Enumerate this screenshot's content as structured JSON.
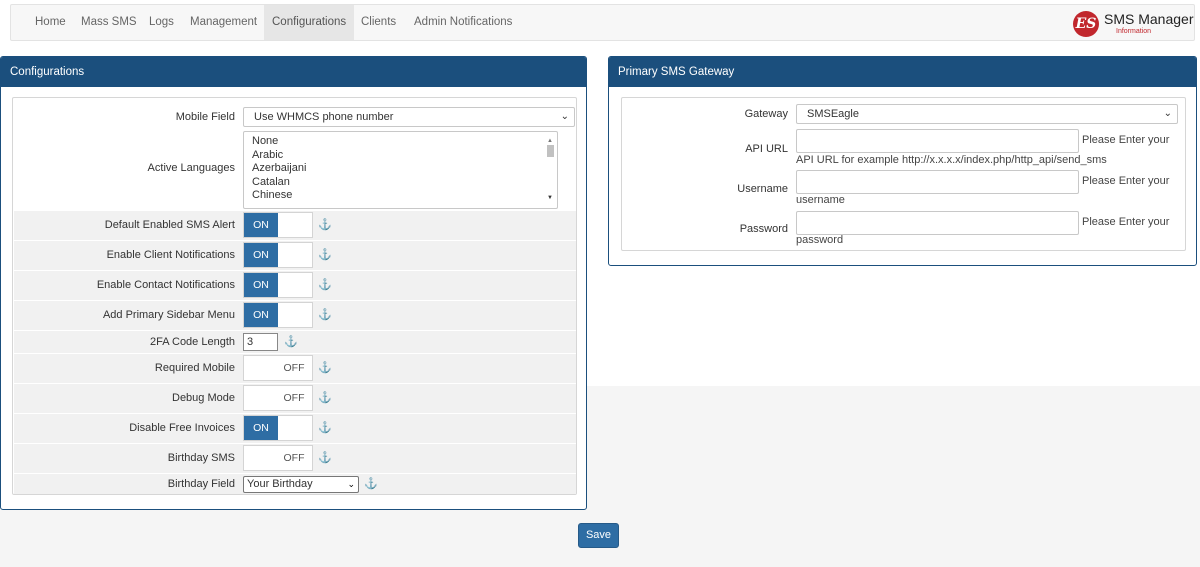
{
  "nav": {
    "items": [
      {
        "label": "Home"
      },
      {
        "label": "Mass SMS"
      },
      {
        "label": "Logs"
      },
      {
        "label": "Management"
      },
      {
        "label": "Configurations"
      },
      {
        "label": "Clients"
      },
      {
        "label": "Admin Notifications"
      }
    ],
    "active": "Configurations",
    "logo": {
      "title": "SMS Manager",
      "subtitle": "Information",
      "mark": "ES"
    }
  },
  "config_panel": {
    "title": "Configurations",
    "mobile_field": {
      "label": "Mobile Field",
      "value": "Use WHMCS phone number"
    },
    "active_languages": {
      "label": "Active Languages",
      "options": [
        "None",
        "Arabic",
        "Azerbaijani",
        "Catalan",
        "Chinese"
      ]
    },
    "toggles": [
      {
        "label": "Default Enabled SMS Alert",
        "state": "ON"
      },
      {
        "label": "Enable Client Notifications",
        "state": "ON"
      },
      {
        "label": "Enable Contact Notifications",
        "state": "ON"
      },
      {
        "label": "Add Primary Sidebar Menu",
        "state": "ON"
      }
    ],
    "code_length": {
      "label": "2FA Code Length",
      "value": "3"
    },
    "toggles2": [
      {
        "label": "Required Mobile",
        "state": "OFF"
      },
      {
        "label": "Debug Mode",
        "state": "OFF"
      },
      {
        "label": "Disable Free Invoices",
        "state": "ON"
      },
      {
        "label": "Birthday SMS",
        "state": "OFF"
      }
    ],
    "birthday_field": {
      "label": "Birthday Field",
      "value": "Your Birthday"
    }
  },
  "gateway_panel": {
    "title": "Primary SMS Gateway",
    "gateway": {
      "label": "Gateway",
      "value": "SMSEagle"
    },
    "api_url": {
      "label": "API URL",
      "value": "",
      "hint_right": "Please Enter your",
      "hint_below": "API URL for example http://x.x.x.x/index.php/http_api/send_sms"
    },
    "username": {
      "label": "Username",
      "value": "",
      "hint_right": "Please Enter your",
      "hint_below": "username"
    },
    "password": {
      "label": "Password",
      "value": "",
      "hint_right": "Please Enter your",
      "hint_below": "password"
    }
  },
  "actions": {
    "save_label": "Save"
  },
  "colors": {
    "accent": "#2e6da4",
    "panel_header": "#1b4f7d",
    "logo_red": "#c1272d"
  },
  "icons": {
    "help": "anchor-help-icon",
    "dropdown": "chevron-down-icon"
  }
}
